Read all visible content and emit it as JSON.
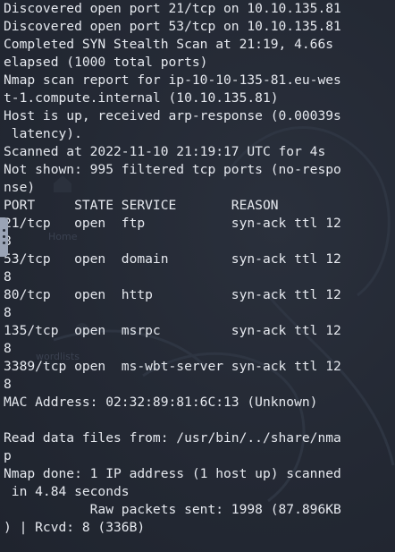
{
  "terminal": {
    "lines": [
      "Discovered open port 21/tcp on 10.10.135.81",
      "Discovered open port 53/tcp on 10.10.135.81",
      "Completed SYN Stealth Scan at 21:19, 4.66s",
      "elapsed (1000 total ports)",
      "Nmap scan report for ip-10-10-135-81.eu-wes",
      "t-1.compute.internal (10.10.135.81)",
      "Host is up, received arp-response (0.00039s",
      " latency).",
      "Scanned at 2022-11-10 21:19:17 UTC for 4s",
      "Not shown: 995 filtered tcp ports (no-respo",
      "nse)",
      "PORT     STATE SERVICE       REASON",
      "21/tcp   open  ftp           syn-ack ttl 12",
      "8",
      "53/tcp   open  domain        syn-ack ttl 12",
      "8",
      "80/tcp   open  http          syn-ack ttl 12",
      "8",
      "135/tcp  open  msrpc         syn-ack ttl 12",
      "8",
      "3389/tcp open  ms-wbt-server syn-ack ttl 12",
      "8",
      "MAC Address: 02:32:89:81:6C:13 (Unknown)",
      "",
      "Read data files from: /usr/bin/../share/nma",
      "p",
      "Nmap done: 1 IP address (1 host up) scanned",
      " in 4.84 seconds",
      "           Raw packets sent: 1998 (87.896KB",
      ") | Rcvd: 8 (336B)"
    ]
  },
  "desktop": {
    "icon_labels": [
      "Home",
      "wordlists"
    ]
  }
}
